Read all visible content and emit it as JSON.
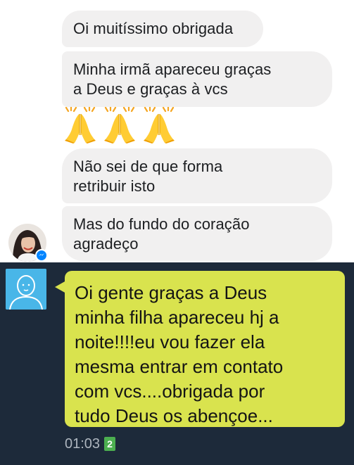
{
  "messenger": {
    "messages": [
      {
        "text": "Oi muitíssimo obrigada"
      },
      {
        "text": "Minha irmã apareceu graças\na Deus e graças à vcs"
      },
      {
        "text": "Não sei de que forma\nretribuir isto"
      },
      {
        "text": "Mas do fundo do coração\nagradeço"
      }
    ],
    "emoji": {
      "name": "folded-hands",
      "count": 3
    },
    "avatar": {
      "icon": "profile-photo",
      "badge_icon": "messenger-icon",
      "badge_color": "#0084ff"
    },
    "bubble_color": "#f1f0f0"
  },
  "chat": {
    "background_color": "#1d2a3a",
    "bubble_color": "#d9e34e",
    "avatar_color": "#49b6e8",
    "avatar_icon": "default-user-icon",
    "message": "Oi gente graças a Deus\nminha filha apareceu hj a\nnoite!!!!eu vou fazer ela\nmesma entrar em contato\ncom vcs....obrigada por\ntudo Deus os abençoe...",
    "time": "01:03",
    "badge": "2"
  }
}
